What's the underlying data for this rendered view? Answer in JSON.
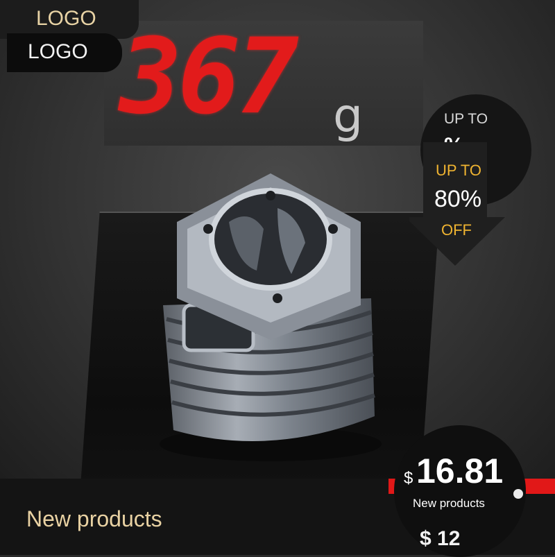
{
  "scale": {
    "digits": "367",
    "unit": "g"
  },
  "logo": {
    "back_text": "LOGO",
    "front_text": "LOGO"
  },
  "badge": {
    "ghost_upto": "UP TO",
    "ghost_percent": "%"
  },
  "discount": {
    "upto": "UP TO",
    "percent": "80%",
    "off": "OFF"
  },
  "footer": {
    "title": "New products"
  },
  "price": {
    "currency": "$",
    "amount": "16.81",
    "caption": "New products",
    "ghost": "$ 12"
  },
  "colors": {
    "accent_gold": "#f0b431",
    "digit_red": "#e21b1b",
    "logo_gold": "#e8d3a5",
    "red_bar": "#e11818"
  }
}
